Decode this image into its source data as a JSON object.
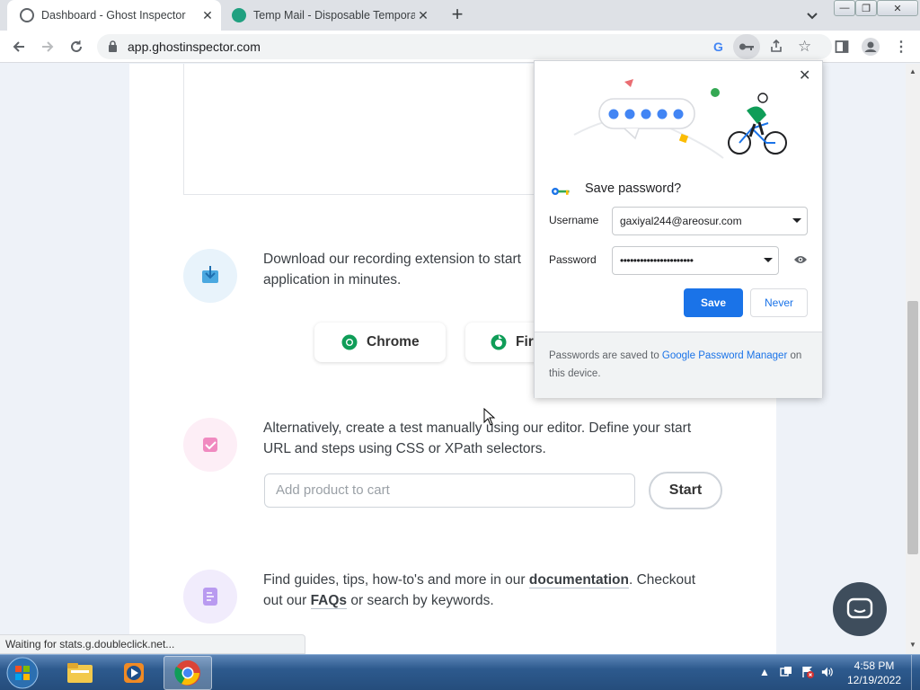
{
  "browser": {
    "tabs": [
      {
        "title": "Dashboard - Ghost Inspector",
        "active": true
      },
      {
        "title": "Temp Mail - Disposable Temporar",
        "active": false
      }
    ],
    "new_tab_symbol": "+",
    "url": "app.ghostinspector.com",
    "status_text": "Waiting for stats.g.doubleclick.net..."
  },
  "page": {
    "recording": {
      "text": "Download our recording extension to start application in minutes.",
      "line1": "Download our recording extension to start",
      "line2": "application in minutes.",
      "buttons": [
        {
          "label": "Chrome"
        },
        {
          "label": "Fir"
        }
      ]
    },
    "manual": {
      "line1": "Alternatively, create a test manually using our editor. Define your start",
      "line2": "URL and steps using CSS or XPath selectors.",
      "input_placeholder": "Add product to cart",
      "start_label": "Start"
    },
    "docs": {
      "line1_pre": "Find guides, tips, how-to's and more in our ",
      "line1_link": "documentation",
      "line1_post": ". Checkout",
      "line2_pre": "out our ",
      "line2_link": "FAQs",
      "line2_post": " or search by keywords."
    }
  },
  "password_popup": {
    "title": "Save password?",
    "username_label": "Username",
    "username_value": "gaxiyal244@areosur.com",
    "password_label": "Password",
    "password_value": "••••••••••••••••••••••",
    "save_label": "Save",
    "never_label": "Never",
    "footer_pre": "Passwords are saved to ",
    "footer_link": "Google Password Manager",
    "footer_post": " on this device."
  },
  "taskbar": {
    "time": "4:58 PM",
    "date": "12/19/2022"
  },
  "colors": {
    "accent": "#1a73e8",
    "chrome_green": "#0f9d58",
    "chat_button": "#3e4d5c"
  }
}
